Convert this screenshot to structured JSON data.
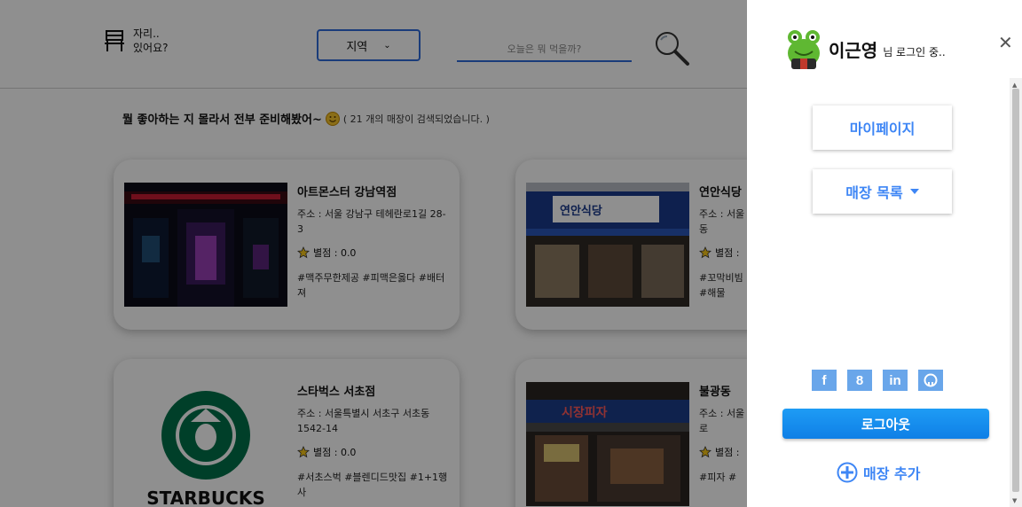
{
  "header": {
    "logo_line1": "자리..",
    "logo_line2": "있어요?",
    "region_label": "지역",
    "search_placeholder": "오늘은 뭐 먹을까?"
  },
  "notice": {
    "message": "뭘 좋아하는 지 몰라서 전부 준비해봤어~",
    "count_text": "( 21 개의 매장이 검색되었습니다. )"
  },
  "stores": [
    {
      "name": "아트몬스터 강남역점",
      "address": "주소 : 서울 강남구 테헤란로1길 28-3",
      "rating": "별점 : 0.0",
      "tags": "#맥주무한제공 #피맥은옳다 #배터져"
    },
    {
      "name": "연안식당",
      "address": "주소 : 서울",
      "address2": "동",
      "rating": "별점 :",
      "tags": "#꼬막비빔",
      "tags2": "#해물"
    },
    {
      "name": "스타벅스 서초점",
      "address": "주소 : 서울특별시 서초구 서초동 1542-14",
      "rating": "별점 : 0.0",
      "tags": "#서초스벅 #블렌디드맛집 #1+1행사"
    },
    {
      "name": "불광동",
      "address": "주소 : 서울",
      "address2": "로",
      "rating": "별점 :",
      "tags": "#피자 #"
    }
  ],
  "images": {
    "sign_text": "연안식당",
    "market_sign": "시장피자",
    "starbucks_word": "STARBUCKS"
  },
  "panel": {
    "user_name": "이근영",
    "user_suffix": "님 로그인 중..",
    "mypage_label": "마이페이지",
    "store_list_label": "매장 목록",
    "logout_label": "로그아웃",
    "add_store_label": "매장 추가",
    "socials": [
      "f",
      "8",
      "in",
      "gh"
    ]
  },
  "colors": {
    "accent": "#3e86f5",
    "logout": "#1e9cf5",
    "social": "#69a6ea"
  }
}
